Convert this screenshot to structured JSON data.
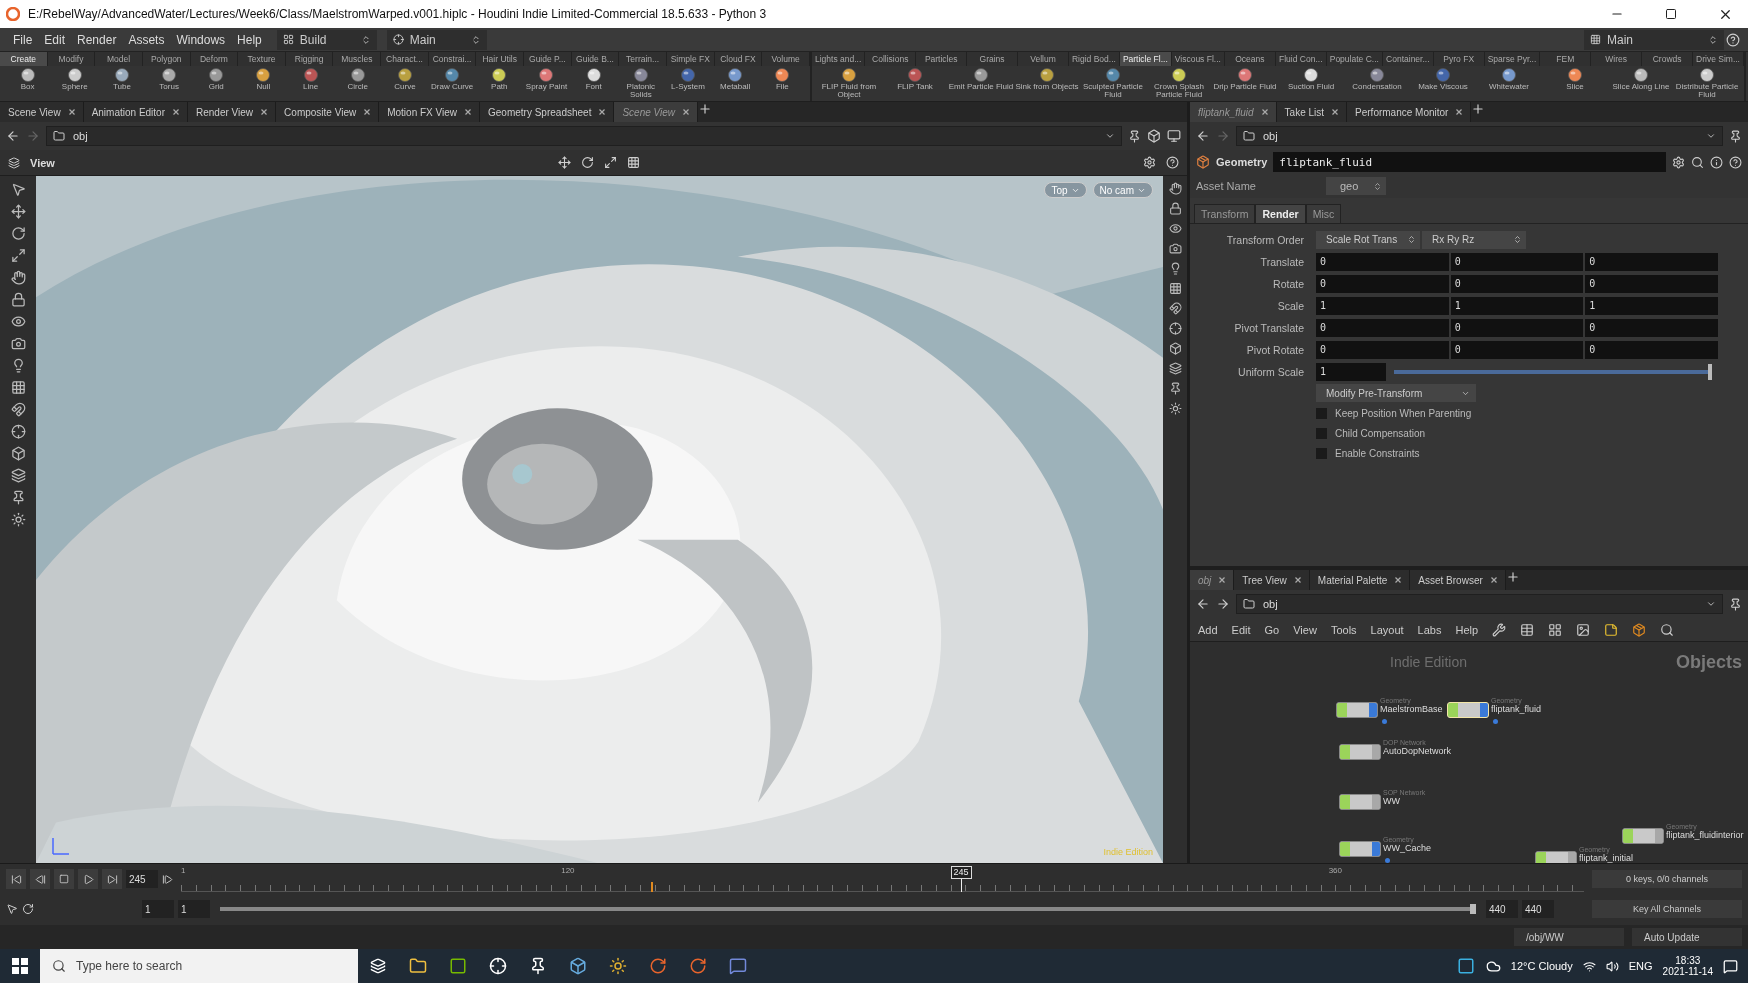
{
  "window": {
    "title": "E:/RebelWay/AdvancedWater/Lectures/Week6/Class/MaelstromWarped.v001.hiplc - Houdini Indie Limited-Commercial 18.5.633 - Python 3"
  },
  "menu": [
    "File",
    "Edit",
    "Render",
    "Assets",
    "Windows",
    "Help"
  ],
  "desktop_selectors": [
    "Build",
    "Main"
  ],
  "desktop_right": "Main",
  "shelf_left": {
    "tabs": [
      {
        "label": "Create",
        "selected": true
      },
      {
        "label": "Modify",
        "selected": false
      },
      {
        "label": "Model",
        "selected": false
      },
      {
        "label": "Polygon",
        "selected": false
      },
      {
        "label": "Deform",
        "selected": false
      },
      {
        "label": "Texture",
        "selected": false
      },
      {
        "label": "Rigging",
        "selected": false
      },
      {
        "label": "Muscles",
        "selected": false
      },
      {
        "label": "Charact...",
        "selected": false
      },
      {
        "label": "Constrai...",
        "selected": false
      },
      {
        "label": "Hair Utils",
        "selected": false
      },
      {
        "label": "Guide P...",
        "selected": false
      },
      {
        "label": "Guide B...",
        "selected": false
      },
      {
        "label": "Terrain...",
        "selected": false
      },
      {
        "label": "Simple FX",
        "selected": false
      },
      {
        "label": "Cloud FX",
        "selected": false
      },
      {
        "label": "Volume",
        "selected": false
      }
    ],
    "tools": [
      "Box",
      "Sphere",
      "Tube",
      "Torus",
      "Grid",
      "Null",
      "Line",
      "Circle",
      "Curve",
      "Draw Curve",
      "Path",
      "Spray Paint",
      "Font",
      "Platonic Solids",
      "L-System",
      "Metaball",
      "File"
    ]
  },
  "shelf_right": {
    "tabs": [
      {
        "label": "Lights and...",
        "selected": false
      },
      {
        "label": "Collisions",
        "selected": false
      },
      {
        "label": "Particles",
        "selected": false
      },
      {
        "label": "Grains",
        "selected": false
      },
      {
        "label": "Vellum",
        "selected": false
      },
      {
        "label": "Rigid Bod...",
        "selected": false
      },
      {
        "label": "Particle Fl...",
        "selected": true
      },
      {
        "label": "Viscous Fl...",
        "selected": false
      },
      {
        "label": "Oceans",
        "selected": false
      },
      {
        "label": "Fluid Con...",
        "selected": false
      },
      {
        "label": "Populate C...",
        "selected": false
      },
      {
        "label": "Container...",
        "selected": false
      },
      {
        "label": "Pyro FX",
        "selected": false
      },
      {
        "label": "Sparse Pyr...",
        "selected": false
      },
      {
        "label": "FEM",
        "selected": false
      },
      {
        "label": "Wires",
        "selected": false
      },
      {
        "label": "Crowds",
        "selected": false
      },
      {
        "label": "Drive Sim...",
        "selected": false
      }
    ],
    "tools": [
      "FLIP Fluid from Object",
      "FLIP Tank",
      "Emit Particle Fluid",
      "Sink from Objects",
      "Sculpted Particle Fluid",
      "Crown Splash Particle Fluid",
      "Drip Particle Fluid",
      "Suction Fluid",
      "Condensation",
      "Make Viscous",
      "Whitewater",
      "Slice",
      "Slice Along Line",
      "Distribute Particle Fluid"
    ]
  },
  "scene_pane": {
    "tabs": [
      {
        "label": "Scene View",
        "selected": false
      },
      {
        "label": "Animation Editor",
        "selected": false
      },
      {
        "label": "Render View",
        "selected": false
      },
      {
        "label": "Composite View",
        "selected": false
      },
      {
        "label": "Motion FX View",
        "selected": false
      },
      {
        "label": "Geometry Spreadsheet",
        "selected": false
      },
      {
        "label": "Scene View",
        "selected": true
      }
    ],
    "path": "obj",
    "view_label": "View",
    "camera_buttons": [
      "Top",
      "No cam"
    ],
    "edition_label": "Indie Edition",
    "viewport": {
      "kind": "picture"
    }
  },
  "param_pane": {
    "tabs": [
      {
        "label": "fliptank_fluid",
        "selected": true
      },
      {
        "label": "Take List",
        "selected": false
      },
      {
        "label": "Performance Monitor",
        "selected": false
      }
    ],
    "path": "obj",
    "node_type": "Geometry",
    "node_name": "fliptank_fluid",
    "asset_name_label": "Asset Name",
    "asset_name": "geo",
    "folders": [
      {
        "label": "Transform",
        "selected": false
      },
      {
        "label": "Render",
        "selected": true
      },
      {
        "label": "Misc",
        "selected": false
      }
    ],
    "transform_order": {
      "label": "Transform Order",
      "values": [
        "Scale Rot Trans",
        "Rx Ry Rz"
      ]
    },
    "vectors": [
      {
        "label": "Translate",
        "values": [
          "0",
          "0",
          "0"
        ]
      },
      {
        "label": "Rotate",
        "values": [
          "0",
          "0",
          "0"
        ]
      },
      {
        "label": "Scale",
        "values": [
          "1",
          "1",
          "1"
        ]
      },
      {
        "label": "Pivot Translate",
        "values": [
          "0",
          "0",
          "0"
        ]
      },
      {
        "label": "Pivot Rotate",
        "values": [
          "0",
          "0",
          "0"
        ]
      }
    ],
    "uniform_scale": {
      "label": "Uniform Scale",
      "value": "1",
      "level": 1
    },
    "menu_button": "Modify Pre-Transform",
    "checkboxes": [
      {
        "label": "Keep Position When Parenting",
        "checked": false
      },
      {
        "label": "Child Compensation",
        "checked": false
      },
      {
        "label": "Enable Constraints",
        "checked": false
      }
    ]
  },
  "network_pane": {
    "tabs": [
      {
        "label": "obj",
        "selected": true
      },
      {
        "label": "Tree View",
        "selected": false
      },
      {
        "label": "Material Palette",
        "selected": false
      },
      {
        "label": "Asset Browser",
        "selected": false
      }
    ],
    "path": "obj",
    "menu": [
      "Add",
      "Edit",
      "Go",
      "View",
      "Tools",
      "Layout",
      "Labs",
      "Help"
    ],
    "edition_label": "Indie Edition",
    "context_label": "Objects",
    "nodes": [
      {
        "type": "Geometry",
        "name": "MaelstromBase",
        "selected": false,
        "display": true
      },
      {
        "type": "Geometry",
        "name": "fliptank_fluid",
        "selected": true,
        "display": true
      },
      {
        "type": "DOP Network",
        "name": "AutoDopNetwork",
        "selected": false,
        "display": false
      },
      {
        "type": "SOP Network",
        "name": "WW",
        "selected": false,
        "display": false
      },
      {
        "type": "Geometry",
        "name": "WW_Cache",
        "selected": false,
        "display": true
      },
      {
        "type": "Geometry",
        "name": "fliptank_fluidinterior",
        "selected": false,
        "display": false
      },
      {
        "type": "Geometry",
        "name": "fliptank_initial",
        "selected": false,
        "display": false
      }
    ]
  },
  "timeline": {
    "frame": "245",
    "playhead": {
      "label": "245",
      "level": 0.556
    },
    "key_marker": {
      "level": 0.335
    },
    "ruler_labels": [
      {
        "text": "1",
        "level": 0
      },
      {
        "text": "120",
        "level": 0.271
      },
      {
        "text": "360",
        "level": 0.818
      }
    ],
    "range": [
      "1",
      "1",
      "440",
      "440"
    ],
    "range_bar": {
      "level": 1
    },
    "keys_info": "0 keys, 0/0 channels",
    "key_button": "Key All Channels"
  },
  "status": {
    "path": "/obj/WW",
    "update_mode": "Auto Update"
  },
  "taskbar": {
    "search_placeholder": "Type here to search",
    "weather": "12°C Cloudy",
    "language": "ENG",
    "time": "18:33",
    "date": "2021-11-14"
  }
}
